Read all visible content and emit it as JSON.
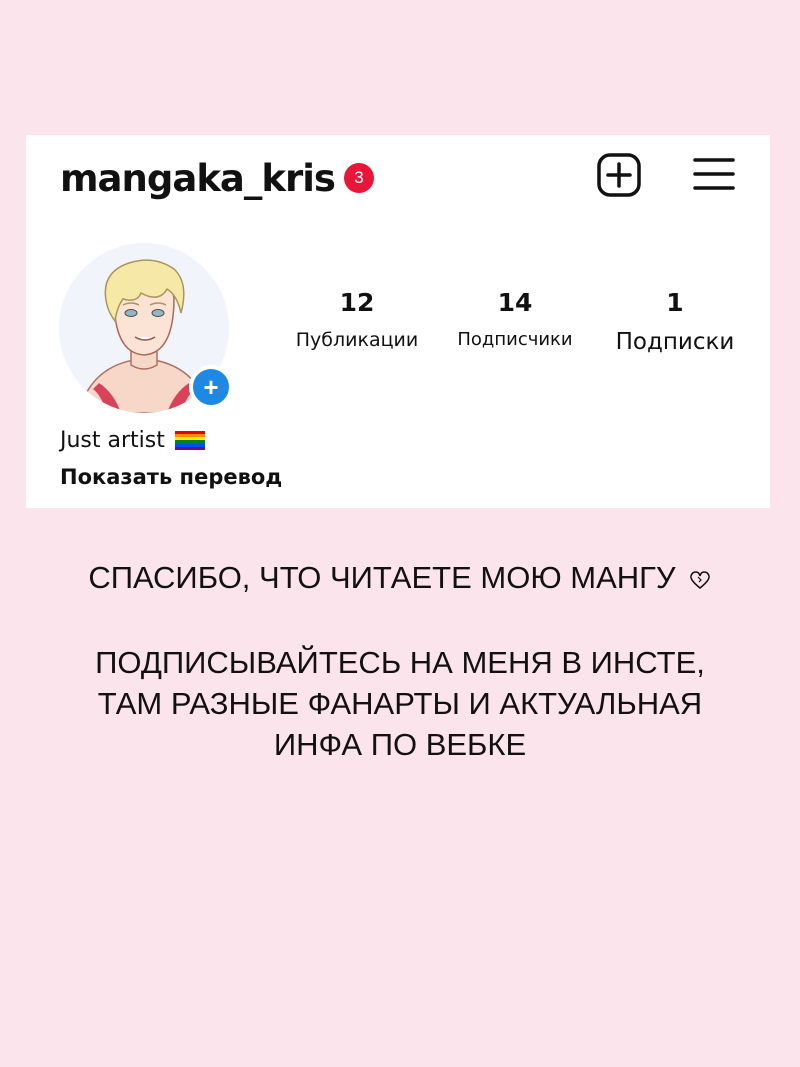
{
  "profile": {
    "username": "mangaka_kris",
    "notification_count": "3",
    "bio": "Just artist",
    "translate_link": "Показать перевод"
  },
  "icons": {
    "add": "add-post-icon",
    "menu": "hamburger-menu-icon",
    "avatar_add": "plus-icon",
    "bio_flag": "rainbow-flag-icon",
    "heart": "heart-icon"
  },
  "stats": {
    "posts": {
      "value": "12",
      "label": "Публикации"
    },
    "followers": {
      "value": "14",
      "label": "Подписчики"
    },
    "following": {
      "value": "1",
      "label": "Подписки"
    }
  },
  "message": {
    "line1": "СПАСИБО, ЧТО ЧИТАЕТЕ МОЮ МАНГУ",
    "line2": "ПОДПИСЫВАЙТЕСЬ НА МЕНЯ В ИНСТЕ,",
    "line3": "ТАМ РАЗНЫЕ ФАНАРТЫ И АКТУАЛЬНАЯ",
    "line4": "ИНФА ПО ВЕБКЕ"
  },
  "colors": {
    "background": "#fce4ec",
    "badge": "#e8173a",
    "avatar_plus": "#1e88e5"
  }
}
